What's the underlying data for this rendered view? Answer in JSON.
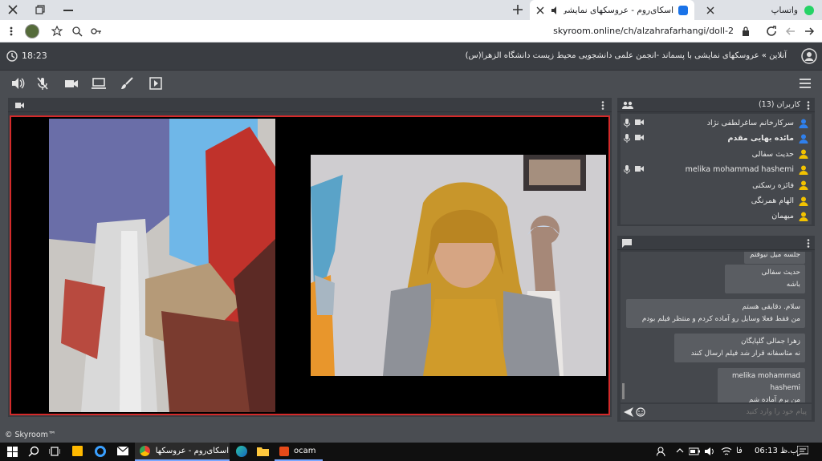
{
  "browser": {
    "tabs": [
      {
        "label": "واتساپ"
      },
      {
        "label": "اسکای‌روم - عروسکهای نمایشی"
      }
    ],
    "url": "skyroom.online/ch/alzahrafarhangi/doll-2"
  },
  "header": {
    "time": "18:23",
    "title": "آنلاین » عروسکهای نمایشی با پسماند -انجمن علمی دانشجویی محیط زیست دانشگاه الزهرا(س)"
  },
  "users": {
    "title": "کاربران (13)",
    "list": [
      {
        "name": "سرکارخانم ساغرلطفی نژاد",
        "color": "#2f80ed",
        "bold": false
      },
      {
        "name": "مائده بهایی مقدم",
        "color": "#2f80ed",
        "bold": true
      },
      {
        "name": "حدیث سفالی",
        "color": "#f2c200",
        "bold": false
      },
      {
        "name": "melika mohammad hashemi",
        "color": "#f2c200",
        "bold": false
      },
      {
        "name": "فائزه رسکتی",
        "color": "#f2c200",
        "bold": false
      },
      {
        "name": "الهام همرنگی",
        "color": "#f2c200",
        "bold": false
      },
      {
        "name": "میهمان",
        "color": "#f2c200",
        "bold": false
      }
    ]
  },
  "chat": {
    "messages": [
      {
        "name": "",
        "text": "جلسه میل نیوفتم"
      },
      {
        "name": "حدیث سفالی",
        "text": "باشه"
      },
      {
        "name": "",
        "text": "سلام. دقایقی هستم"
      },
      {
        "name": "",
        "text": "من فقط فعلا وسایل رو آماده کردم  و منتظر فیلم بودم"
      },
      {
        "name": "زهرا جمالی گلپایگان",
        "text": "نه متاسفانه قرار شد فیلم ارسال کنند"
      },
      {
        "name": "melika mohammad hashemi",
        "text": "من برم آماده شم"
      }
    ],
    "input_placeholder": "پیام خود را وارد کنید"
  },
  "footer": {
    "brand": "© Skyroom™"
  },
  "taskbar": {
    "chrome_label": "اسکای‌روم - عروسکهای",
    "ocam_label": "ocam",
    "lang": "فا",
    "clock": "ب.ظ 06:13"
  },
  "colors": {
    "accent_blue": "#2f80ed",
    "guest_yellow": "#f2c200",
    "frame_red": "#d42a2a"
  }
}
